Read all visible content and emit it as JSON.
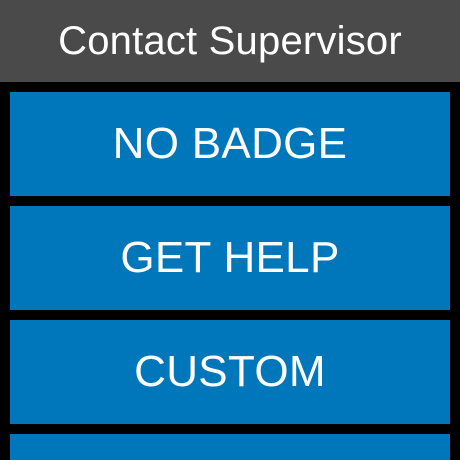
{
  "header": {
    "title": "Contact Supervisor"
  },
  "options": [
    {
      "label": "NO BADGE"
    },
    {
      "label": "GET HELP"
    },
    {
      "label": "CUSTOM"
    },
    {
      "label": ""
    }
  ],
  "colors": {
    "background": "#000000",
    "header_background": "#4a4a4a",
    "button_background": "#0077bb",
    "text": "#ffffff"
  }
}
